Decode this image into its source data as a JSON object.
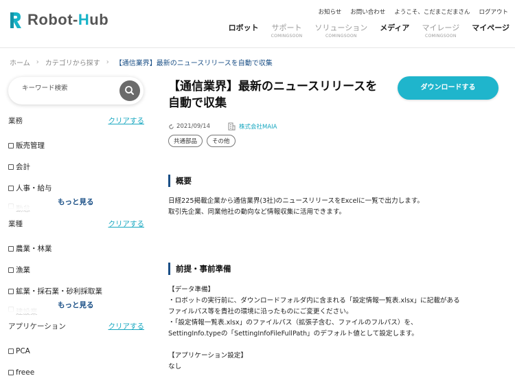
{
  "header": {
    "logo_text_a": "Robot-",
    "logo_text_b": "H",
    "logo_text_c": "ub",
    "util_links": [
      "お知らせ",
      "お問い合わせ",
      "ようこそ、こだまこだまさん",
      "ログアウト"
    ],
    "nav": [
      {
        "label": "ロボット",
        "sub": "",
        "disabled": false
      },
      {
        "label": "サポート",
        "sub": "COMINGSOON",
        "disabled": true
      },
      {
        "label": "ソリューション",
        "sub": "COMINGSOON",
        "disabled": true
      },
      {
        "label": "メディア",
        "sub": "",
        "disabled": false
      },
      {
        "label": "マイレージ",
        "sub": "COMINGSOON",
        "disabled": true
      },
      {
        "label": "マイページ",
        "sub": "",
        "disabled": false
      }
    ]
  },
  "breadcrumb": {
    "home": "ホーム",
    "category": "カテゴリから探す",
    "current": "【通信業界】最新のニュースリリースを自動で収集"
  },
  "sidebar": {
    "search_placeholder": "キーワード検索",
    "clear_label": "クリアする",
    "more_label": "もっと見る",
    "sections": [
      {
        "title": "業務",
        "items": [
          "販売管理",
          "会計",
          "人事・給与"
        ],
        "faded": "勤怠"
      },
      {
        "title": "業種",
        "items": [
          "農業・林業",
          "漁業",
          "鉱業・採石業・砂利採取業"
        ],
        "faded": "建設業"
      },
      {
        "title": "アプリケーション",
        "items": [
          "PCA",
          "freee"
        ]
      }
    ]
  },
  "main": {
    "title": "【通信業界】最新のニュースリリースを自動で収集",
    "download_label": "ダウンロードする",
    "date": "2021/09/14",
    "company": "株式会社MAIA",
    "tags": [
      "共通部品",
      "その他"
    ],
    "overview_title": "概要",
    "overview_lines": [
      "日経225掲載企業から通信業界(3社)のニュースリリースをExcelに一覧で出力します。",
      "取引先企業、同業他社の動向など情報収集に活用できます。"
    ],
    "prep_title": "前提・事前準備",
    "prep_lines": [
      "【データ準備】",
      "・ロボットの実行前に、ダウンロードフォルダ内に含まれる「設定情報一覧表.xlsx」に記載がある",
      "ファイルパス等を貴社の環境に沿ったものにご変更ください。",
      "・「設定情報一覧表.xlsx」のファイルパス（拡張子含む、ファイルのフルパス）を、",
      "SettingInfo.typeの「SettingInfoFileFullPath」のデフォルト値として設定します。",
      "",
      "【アプリケーション設定】",
      "なし"
    ]
  },
  "colors": {
    "accent": "#1fb5cc",
    "navy": "#1a4f86"
  }
}
